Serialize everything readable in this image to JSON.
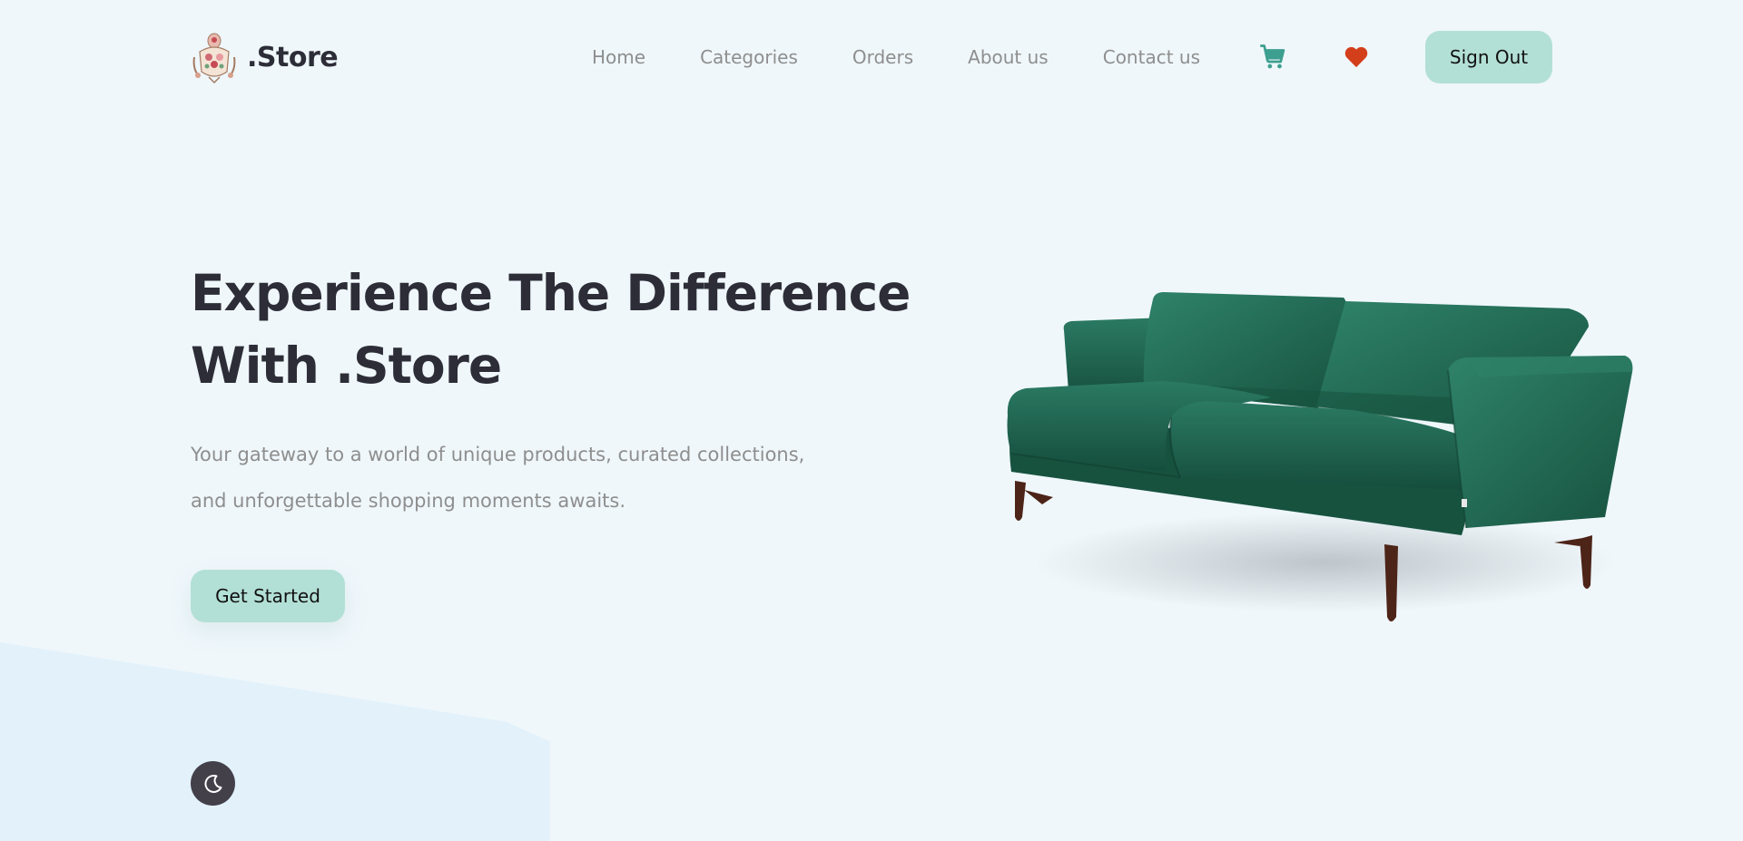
{
  "brand": {
    "name": ".Store"
  },
  "nav": {
    "items": [
      "Home",
      "Categories",
      "Orders",
      "About us",
      "Contact us"
    ]
  },
  "header": {
    "cart_icon": "cart-icon",
    "wishlist_icon": "heart-icon",
    "signout_label": "Sign Out"
  },
  "hero": {
    "title_line1": "Experience The Difference",
    "title_line2": "With .Store",
    "subtitle_line1": "Your gateway to a world of unique products, curated collections,",
    "subtitle_line2": "and unforgettable shopping moments awaits.",
    "cta_label": "Get Started",
    "image": "green-velvet-sofa"
  },
  "theme_toggle": {
    "icon": "moon-icon"
  },
  "colors": {
    "background": "#eff7fb",
    "accent": "#b3e0d6",
    "cart": "#3d9f8f",
    "heart": "#d33f1b",
    "heading": "#2d2d38",
    "muted": "#8e8e8e",
    "sofa": "#20604c"
  }
}
